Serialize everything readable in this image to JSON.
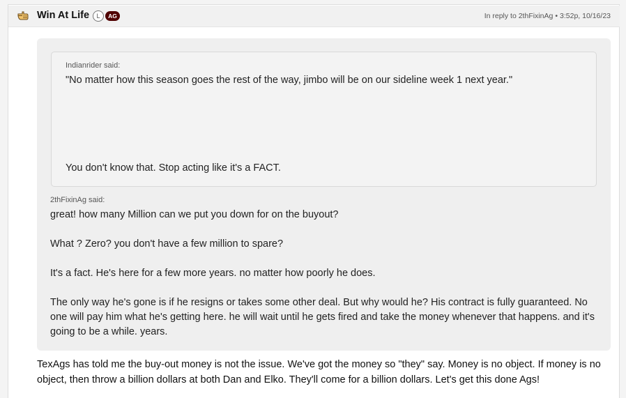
{
  "post": {
    "username": "Win At Life",
    "badge_l": "L",
    "badge_ag": "AG",
    "reply_to_label": "In reply to",
    "reply_to_user": "2thFixinAg",
    "separator": "•",
    "timestamp": "3:52p, 10/16/23",
    "icon": "pointing-hand-icon"
  },
  "inner_quote": {
    "attribution": "Indianrider said:",
    "quote_line": "\"No matter how this season goes the rest of the way, jimbo will be on our sideline week 1 next year.\"",
    "reply_line": "You don't know that. Stop acting like it's a FACT."
  },
  "outer_quote": {
    "attribution": "2thFixinAg said:",
    "paragraphs": [
      "great! how many Million can we put you down for on the buyout?",
      "What ? Zero? you don't have a few million to spare?",
      "It's a fact. He's here for a few more years. no matter how poorly he does.",
      "The only way he's gone is if he resigns or takes some other deal. But why would he? His contract is fully guaranteed. No one will pay him what he's getting here. he will wait until he gets fired and take the money whenever that happens. and it's going to be a while. years."
    ]
  },
  "reply_body": "TexAgs has told me the buy-out money is not the issue. We've got the money so \"they\" say. Money is no object. If money is no object, then throw a billion dollars at both Dan and Elko. They'll come for a billion dollars. Let's get this done Ags!",
  "colors": {
    "accent": "#500000",
    "quote_bg": "#efefef",
    "header_bg": "#f1f1f1"
  }
}
